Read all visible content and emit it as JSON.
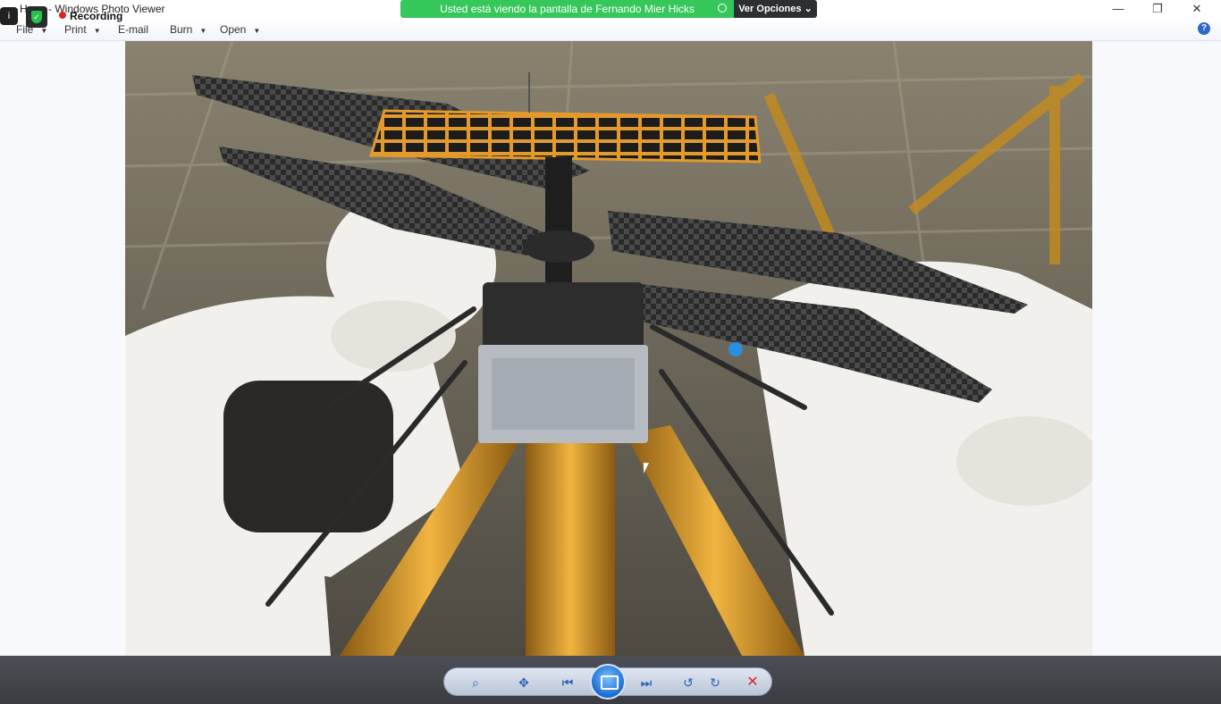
{
  "window": {
    "title": "Hang - Windows Photo Viewer",
    "controls": {
      "minimize": "—",
      "restore": "❐",
      "close": "✕"
    }
  },
  "menu": {
    "items": [
      {
        "label": "File"
      },
      {
        "label": "Print"
      },
      {
        "label": "E-mail"
      },
      {
        "label": "Burn"
      },
      {
        "label": "Open"
      }
    ],
    "help": "?"
  },
  "share_banner": {
    "text": "Usted está viendo la pantalla de Fernando Mier Hicks",
    "options_label": "Ver Opciones ⌄"
  },
  "recording": {
    "info": "i",
    "label": "Recording"
  },
  "toolbar": {
    "zoom": "⌕",
    "fit": "✥",
    "previous": "⏮",
    "next": "⏭",
    "rotate_ccw": "↺",
    "rotate_cw": "↻",
    "delete": "✕"
  },
  "colors": {
    "share_green": "#35c75a",
    "toolbar_blue": "#2a62b8",
    "delete_red": "#d42a2a"
  }
}
